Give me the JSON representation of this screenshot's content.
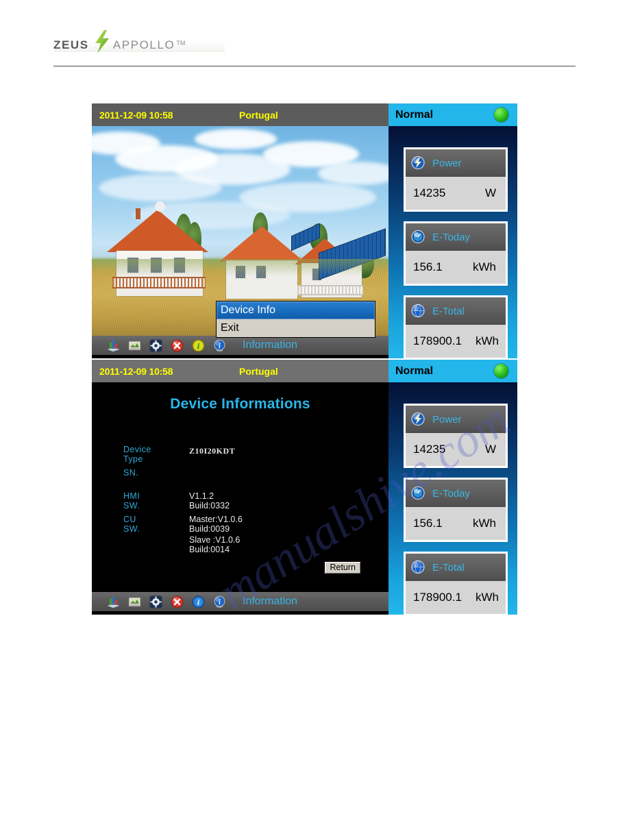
{
  "letterhead": {
    "brand_primary": "ZEUS",
    "brand_secondary": "APPOLLO",
    "trademark": "TM",
    "bolt_icon": "lightning-bolt-icon",
    "colors": {
      "primary_text": "#58595b",
      "secondary_text": "#8b8d8f",
      "bolt": "#8dc63f"
    }
  },
  "watermark": {
    "text": "manualshive.com",
    "color": "#525ac8"
  },
  "screens": [
    {
      "id": "main-screen-with-context-menu",
      "titlebar": {
        "datetime": "2011-12-09 10:58",
        "location": "Portugal"
      },
      "left_kind": "photo",
      "photo_alt": "houses-with-solar-panels-photo",
      "context_menu": {
        "items": [
          {
            "label": "Device Info",
            "selected": true
          },
          {
            "label": "Exit",
            "selected": false
          }
        ]
      },
      "toolbar": {
        "icons": [
          "bar-chart-icon",
          "picture-frame-icon",
          "gear-settings-icon",
          "red-x-close-icon",
          "yellow-info-icon",
          "blue-info-globe-icon"
        ],
        "active_icon_index": 4,
        "label": "Information",
        "label_color": "#38b4e6"
      },
      "panel": {
        "status": "Normal",
        "led": {
          "name": "status-led-green",
          "color": "#3fcf2a"
        },
        "cards": [
          {
            "icon": "power-bolt-globe-icon",
            "title": "Power",
            "value": "14235",
            "unit": "W"
          },
          {
            "icon": "e-today-globe-icon",
            "title": "E-Today",
            "value": "156.1",
            "unit": "kWh"
          },
          {
            "icon": "e-total-globe-icon",
            "title": "E-Total",
            "value": "178900.1",
            "unit": "kWh"
          }
        ]
      }
    },
    {
      "id": "device-informations-screen",
      "titlebar": {
        "datetime": "2011-12-09 10:58",
        "location": "Portugal"
      },
      "left_kind": "info",
      "page_title": "Device Informations",
      "fields": [
        {
          "label": "Device Type",
          "value": "Z10I20KDT",
          "style": "mono"
        },
        {
          "label": "SN.",
          "value": "",
          "style": "plain"
        },
        {
          "label": "HMI SW.",
          "value": "V1.1.2 Build:0332",
          "style": "plain"
        },
        {
          "label": "CU  SW.",
          "value": "Master:V1.0.6 Build:0039",
          "value_line2": "Slave   :V1.0.6 Build:0014",
          "style": "plain"
        }
      ],
      "return_button": "Return",
      "toolbar": {
        "icons": [
          "bar-chart-icon",
          "picture-frame-icon",
          "gear-settings-icon",
          "red-x-close-icon",
          "blue-info-icon",
          "blue-info-globe-icon"
        ],
        "active_icon_index": 5,
        "label": "Information",
        "label_color": "#38b4e6"
      },
      "panel": {
        "status": "Normal",
        "led": {
          "name": "status-led-green",
          "color": "#3fcf2a"
        },
        "cards": [
          {
            "icon": "power-bolt-globe-icon",
            "title": "Power",
            "value": "14235",
            "unit": "W"
          },
          {
            "icon": "e-today-globe-icon",
            "title": "E-Today",
            "value": "156.1",
            "unit": "kWh"
          },
          {
            "icon": "e-total-globe-icon",
            "title": "E-Total",
            "value": "178900.1",
            "unit": "kWh"
          }
        ]
      }
    }
  ]
}
